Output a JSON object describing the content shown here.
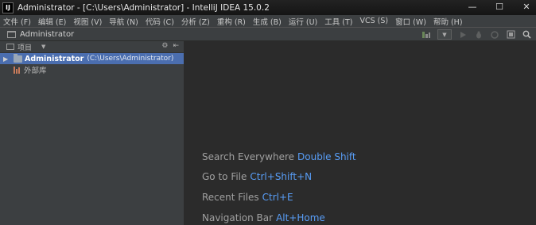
{
  "window": {
    "app_icon": "IJ",
    "title": "Administrator - [C:\\Users\\Administrator] - IntelliJ IDEA 15.0.2",
    "controls": {
      "minimize": "—",
      "maximize": "☐",
      "close": "✕"
    }
  },
  "menu": {
    "items": [
      "文件 (F)",
      "编辑 (E)",
      "视图 (V)",
      "导航 (N)",
      "代码 (C)",
      "分析 (Z)",
      "重构 (R)",
      "生成 (B)",
      "运行 (U)",
      "工具 (T)",
      "VCS (S)",
      "窗口 (W)",
      "帮助 (H)"
    ]
  },
  "navbar": {
    "title": "Administrator",
    "icons": [
      "build-icon",
      "run-config-dropdown",
      "run-icon",
      "debug-icon",
      "stop-icon",
      "project-structure-icon",
      "search-icon"
    ]
  },
  "project_panel": {
    "title": "项目",
    "root": {
      "name": "Administrator",
      "path": "(C:\\Users\\Administrator)"
    },
    "libraries": "外部库"
  },
  "editor": {
    "hints": [
      {
        "label": "Search Everywhere",
        "shortcut": "Double Shift"
      },
      {
        "label": "Go to File",
        "shortcut": "Ctrl+Shift+N"
      },
      {
        "label": "Recent Files",
        "shortcut": "Ctrl+E"
      },
      {
        "label": "Navigation Bar",
        "shortcut": "Alt+Home"
      }
    ]
  },
  "colors": {
    "background": "#2b2b2b",
    "panel": "#3c3f41",
    "selection": "#4b6eaf",
    "shortcut": "#589df6"
  }
}
